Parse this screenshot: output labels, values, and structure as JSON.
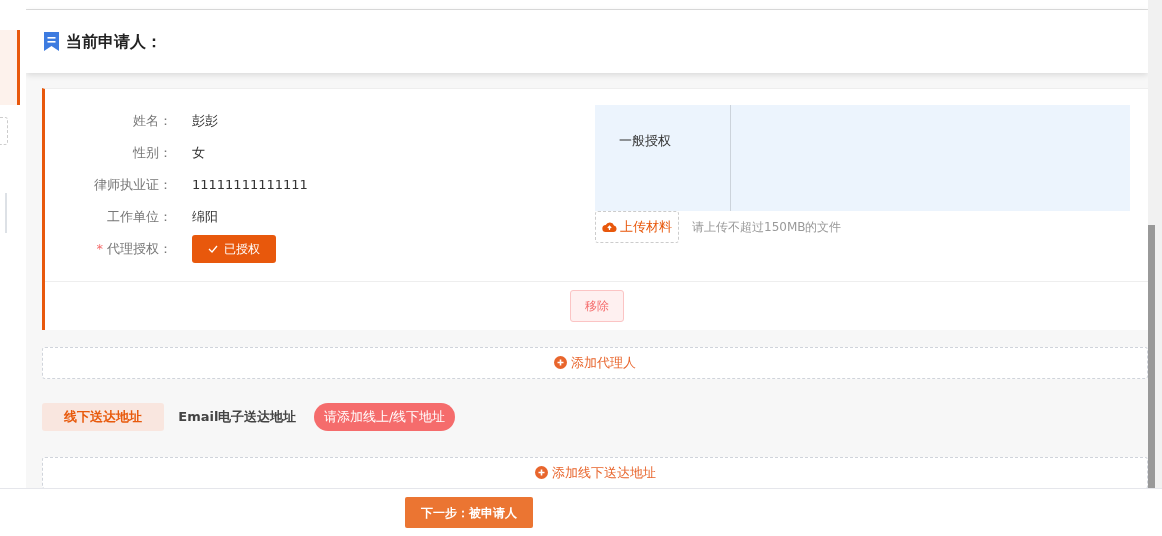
{
  "header": {
    "title": "当前申请人："
  },
  "agent_card": {
    "fields": [
      {
        "label": "姓名：",
        "value": "彭彭"
      },
      {
        "label": "性别：",
        "value": "女"
      },
      {
        "label": "律师执业证：",
        "value": "11111111111111"
      },
      {
        "label": "工作单位：",
        "value": "绵阳"
      },
      {
        "label": "代理授权：",
        "required_mark": "*",
        "kind": "status",
        "status": {
          "label": "已授权",
          "authorized": true
        }
      }
    ],
    "authorization_table": {
      "rows": [
        {
          "type": "一般授权"
        }
      ]
    },
    "upload_button": "上传材料",
    "upload_hint": "请上传不超过150MB的文件",
    "remove_button": "移除"
  },
  "add_agent_button": "添加代理人",
  "address_tabs": [
    {
      "label": "线下送达地址",
      "selected": true
    },
    {
      "label": "Email电子送达地址",
      "selected": false
    }
  ],
  "address_warning": "请添加线上/线下地址",
  "add_address_button": "添加线下送达地址",
  "next_button": "下一步：被申请人"
}
